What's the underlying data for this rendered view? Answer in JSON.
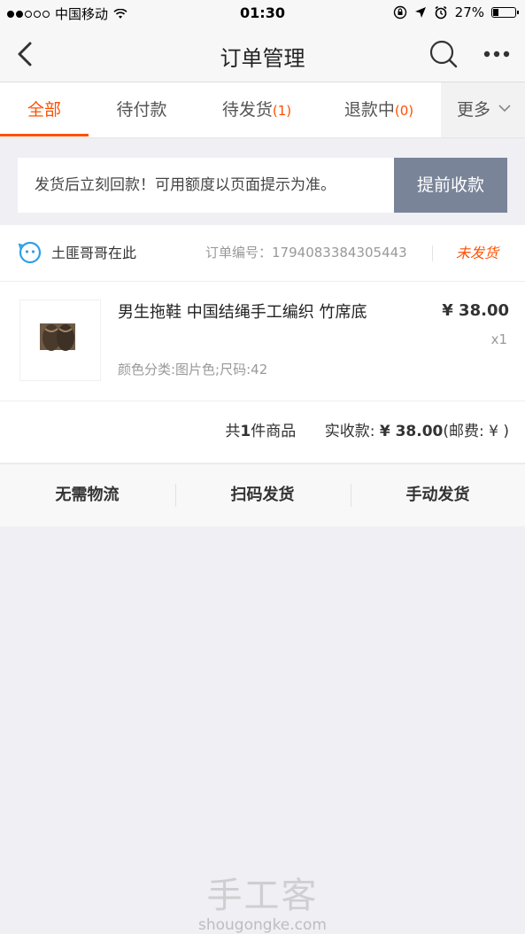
{
  "status_bar": {
    "carrier": "中国移动",
    "time": "01:30",
    "battery_percent": "27%",
    "battery_level": 0.27,
    "icons": [
      "signal-dots-icon",
      "wifi-icon",
      "lock-rotation-icon",
      "location-arrow-icon",
      "alarm-icon",
      "battery-icon"
    ]
  },
  "nav": {
    "title": "订单管理",
    "icons": [
      "back-arrow-icon",
      "search-icon",
      "more-dots-icon"
    ]
  },
  "tabs": [
    {
      "label": "全部",
      "count": "",
      "active": true
    },
    {
      "label": "待付款",
      "count": "",
      "active": false
    },
    {
      "label": "待发货",
      "count": "(1)",
      "active": false
    },
    {
      "label": "退款中",
      "count": "(0)",
      "active": false
    }
  ],
  "tab_more": {
    "label": "更多"
  },
  "notice": {
    "text": "发货后立刻回款！可用额度以页面提示为准。",
    "button_label": "提前收款"
  },
  "order": {
    "shop_name": "土匪哥哥在此",
    "order_number_label": "订单编号：",
    "order_number": "1794083384305443",
    "status": "未发货",
    "product": {
      "title": "男生拖鞋 中国结绳手工编织 竹席底",
      "sku": "颜色分类:图片色;尺码:42",
      "price": "¥ 38.00",
      "quantity": "x1"
    },
    "summary": {
      "prefix": "共",
      "count": "1",
      "count_suffix": "件商品",
      "received_label": "实收款: ",
      "received_amount": "¥ 38.00",
      "shipping": "(邮费: ¥ )"
    }
  },
  "actions": [
    "无需物流",
    "扫码发货",
    "手动发货"
  ],
  "watermark": {
    "logo": "手工客",
    "url": "shougongke.com"
  },
  "colors": {
    "accent": "#ff5000",
    "notice_button": "#7a8499",
    "page_background": "#efeff4"
  }
}
